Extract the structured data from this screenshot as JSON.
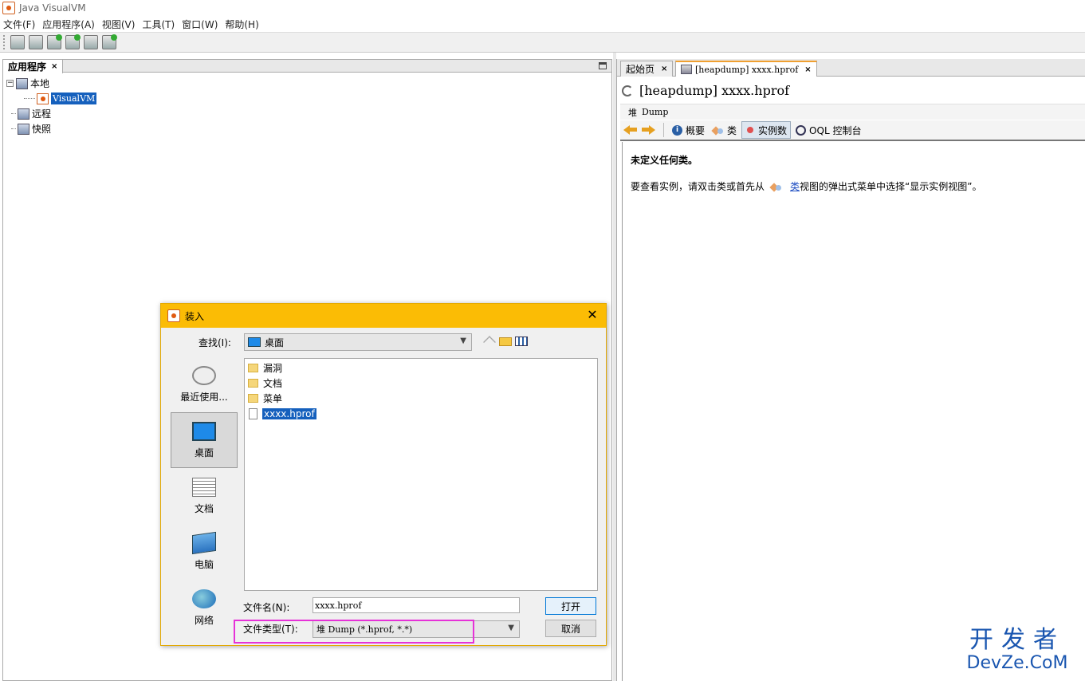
{
  "window": {
    "title": "Java VisualVM"
  },
  "menu": [
    "文件(F)",
    "应用程序(A)",
    "视图(V)",
    "工具(T)",
    "窗口(W)",
    "帮助(H)"
  ],
  "left_panel": {
    "tab_label": "应用程序",
    "tab_close": "×",
    "tree": {
      "local": "本地",
      "local_child": "VisualVM",
      "remote": "远程",
      "snapshots": "快照",
      "expander": "−"
    }
  },
  "right_panel": {
    "tabs": [
      {
        "label": "起始页",
        "close": "×"
      },
      {
        "label": "[heapdump] xxxx.hprof",
        "close": "×"
      }
    ],
    "document_title": "[heapdump] xxxx.hprof",
    "subheader": {
      "prefix": "堆",
      "label": "Dump"
    },
    "views": {
      "summary": "概要",
      "classes": "类",
      "instances": "实例数",
      "oql": "OQL 控制台"
    },
    "message_title": "未定义任何类。",
    "hint_prefix": "要查看实例，请双击类或首先从",
    "hint_link": "类",
    "hint_suffix": "视图的弹出式菜单中选择“显示实例视图”。"
  },
  "dialog": {
    "title": "装入",
    "close": "✕",
    "look_in_label": "查找(I):",
    "look_in_value": "桌面",
    "places": [
      "最近使用...",
      "桌面",
      "文档",
      "电脑",
      "网络"
    ],
    "files": [
      {
        "name": "漏洞",
        "type": "folder"
      },
      {
        "name": "文档",
        "type": "folder"
      },
      {
        "name": "菜单",
        "type": "folder"
      },
      {
        "name": "xxxx.hprof",
        "type": "file",
        "selected": true
      }
    ],
    "file_name_label": "文件名(N):",
    "file_name_value": "xxxx.hprof",
    "file_type_label": "文件类型(T):",
    "file_type_value": "堆 Dump (*.hprof, *.*)",
    "open_button": "打开",
    "cancel_button": "取消",
    "highlight_color": "#e632d8"
  },
  "watermark": {
    "top": "开发者",
    "bottom": "DevZe.CoM"
  },
  "colors": {
    "dialog_title": "#fbbc05",
    "selection": "#1560bd",
    "link": "#1f4ec2"
  }
}
